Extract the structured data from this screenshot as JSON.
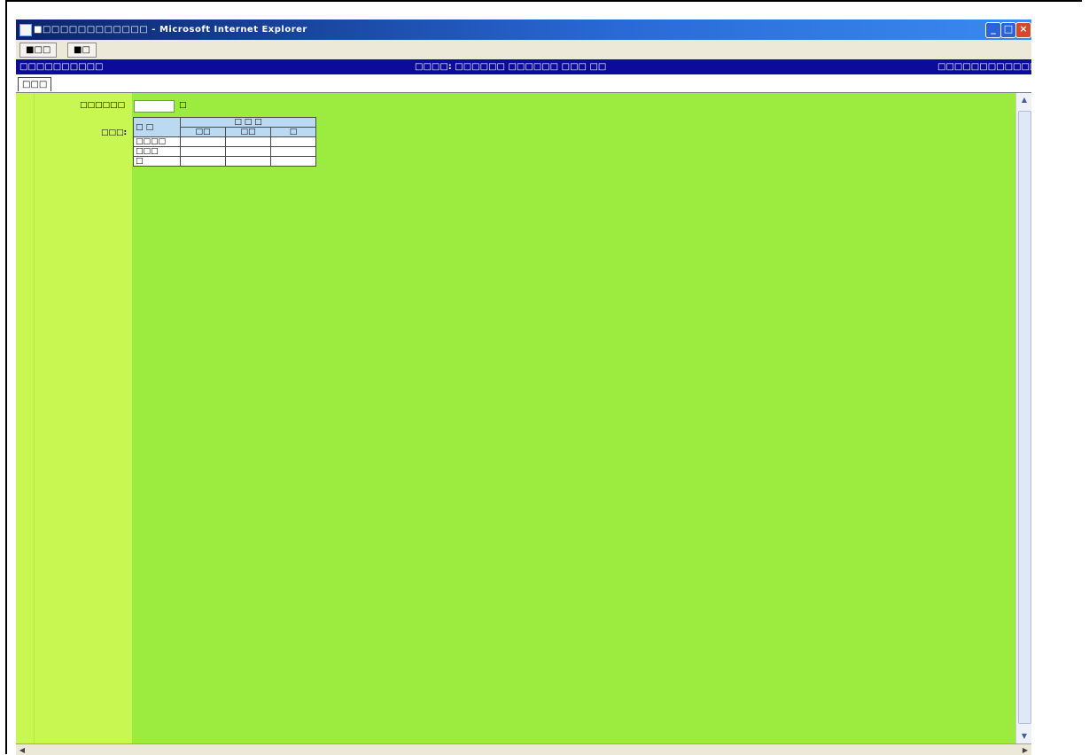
{
  "window": {
    "title": "■□□□□□□□□□□□□ - Microsoft Internet Explorer",
    "minimize_label": "_",
    "maximize_label": "□",
    "close_label": "×"
  },
  "toolbar": {
    "back_label": "■□□",
    "next_label": "■□"
  },
  "appbar": {
    "left_title": "□□□□□□□□□□",
    "center_text": "□□□□: □□□□□□ □□□□□□ □□□ □□",
    "right_text": "□□□□□□□□□□□□"
  },
  "tabs": [
    {
      "label": "□□□"
    }
  ],
  "form": {
    "field_label": "□□□□□□",
    "field_value": "",
    "field_unit": "□",
    "table_label": "□□□:",
    "table": {
      "header_main": "□ □",
      "header_group": "□ □ □",
      "header_cols": [
        "□□",
        "□□",
        "□"
      ],
      "rows": [
        {
          "label": "□□□□",
          "values": [
            "",
            "",
            ""
          ]
        },
        {
          "label": "□□□",
          "values": [
            "",
            "",
            ""
          ]
        },
        {
          "label": "□",
          "values": [
            "",
            "",
            ""
          ]
        }
      ]
    }
  }
}
